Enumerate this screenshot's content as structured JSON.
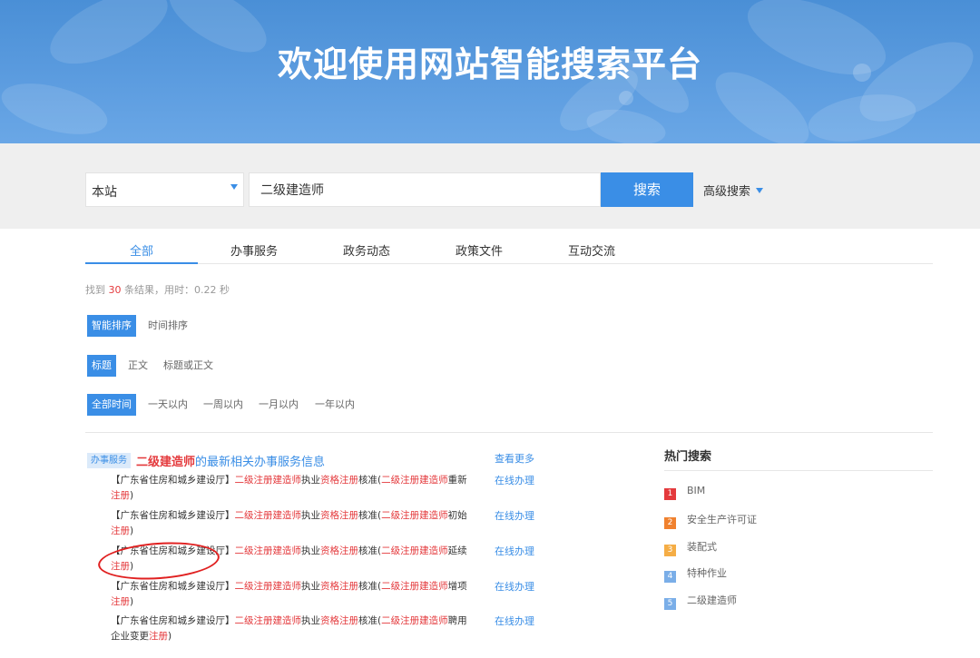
{
  "banner": {
    "title": "欢迎使用网站智能搜索平台"
  },
  "search": {
    "scope": "本站",
    "query": "二级建造师",
    "button": "搜索",
    "advanced": "高级搜索"
  },
  "tabs": [
    "全部",
    "办事服务",
    "政务动态",
    "政策文件",
    "互动交流"
  ],
  "result_count": {
    "prefix": "找到 ",
    "num": "30",
    "suffix": " 条结果，用时：0.22 秒"
  },
  "filters": {
    "sort": [
      "智能排序",
      "时间排序"
    ],
    "field": [
      "标题",
      "正文",
      "标题或正文"
    ],
    "time": [
      "全部时间",
      "一天以内",
      "一周以内",
      "一月以内",
      "一年以内"
    ]
  },
  "services": {
    "tag": "办事服务",
    "heading_kw": "二级建造师",
    "heading_rest": "的最新相关办事服务信息",
    "more": "查看更多",
    "online_label": "在线办理",
    "items": [
      {
        "org": "【广东省住房和城乡建设厅】",
        "kw1": "二级注册建造师",
        "t1": "执业",
        "kw2": "资格注册",
        "t2": "核准(",
        "kw3": "二级注册建造师",
        "t3": "重新",
        "kw4": "注册",
        "t4": ")"
      },
      {
        "org": "【广东省住房和城乡建设厅】",
        "kw1": "二级注册建造师",
        "t1": "执业",
        "kw2": "资格注册",
        "t2": "核准(",
        "kw3": "二级注册建造师",
        "t3": "初始",
        "kw4": "注册",
        "t4": ")"
      },
      {
        "org": "【广东省住房和城乡建设厅】",
        "kw1": "二级注册建造师",
        "t1": "执业",
        "kw2": "资格注册",
        "t2": "核准(",
        "kw3": "二级注册建造师",
        "t3": "延续",
        "kw4": "注册",
        "t4": ")"
      },
      {
        "org": "【广东省住房和城乡建设厅】",
        "kw1": "二级注册建造师",
        "t1": "执业",
        "kw2": "资格注册",
        "t2": "核准(",
        "kw3": "二级注册建造师",
        "t3": "增项",
        "kw4": "注册",
        "t4": ")"
      },
      {
        "org": "【广东省住房和城乡建设厅】",
        "kw1": "二级注册建造师",
        "t1": "执业",
        "kw2": "资格注册",
        "t2": "核准(",
        "kw3": "二级注册建造师",
        "t3": "聘用企业变更",
        "kw4": "注册",
        "t4": ")"
      }
    ]
  },
  "hot": {
    "title": "热门搜索",
    "items": [
      {
        "rank": "1",
        "label": "BIM",
        "color": "#e4393c"
      },
      {
        "rank": "2",
        "label": "安全生产许可证",
        "color": "#f0812e"
      },
      {
        "rank": "3",
        "label": "装配式",
        "color": "#f5ad45"
      },
      {
        "rank": "4",
        "label": "特种作业",
        "color": "#7aaee8"
      },
      {
        "rank": "5",
        "label": "二级建造师",
        "color": "#7aaee8"
      }
    ]
  },
  "colors": {
    "accent": "#3a8ee6",
    "keyword": "#e4393c",
    "annotation": "#e02020"
  }
}
